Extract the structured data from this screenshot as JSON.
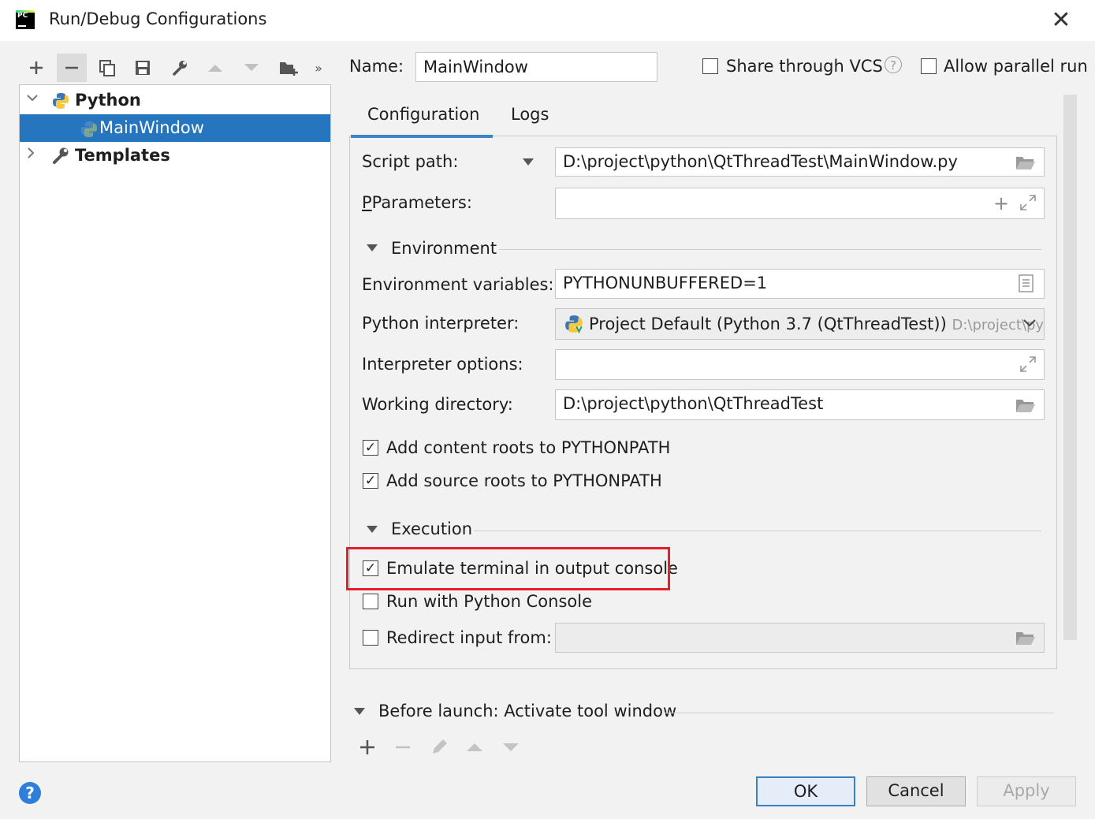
{
  "window": {
    "title": "Run/Debug Configurations"
  },
  "tree": {
    "python_label": "Python",
    "mainwindow_label": "MainWindow",
    "templates_label": "Templates"
  },
  "header": {
    "name_label": "Name:",
    "name_value": "MainWindow",
    "share_vcs_label": "Share through VCS",
    "allow_parallel_label": "Allow parallel run"
  },
  "tabs": [
    {
      "label": "Configuration"
    },
    {
      "label": "Logs"
    }
  ],
  "config": {
    "script_path_label": "Script path:",
    "script_path_value": "D:\\project\\python\\QtThreadTest\\MainWindow.py",
    "parameters_label": "Parameters:",
    "parameters_value": "",
    "environment_section": "Environment",
    "env_vars_label": "Environment variables:",
    "env_vars_value": "PYTHONUNBUFFERED=1",
    "interpreter_label": "Python interpreter:",
    "interpreter_value": "Project Default (Python 3.7 (QtThreadTest))",
    "interpreter_path": "D:\\project\\py",
    "interpreter_options_label": "Interpreter options:",
    "interpreter_options_value": "",
    "working_dir_label": "Working directory:",
    "working_dir_value": "D:\\project\\python\\QtThreadTest",
    "add_content_roots_label": "Add content roots to PYTHONPATH",
    "add_content_roots_checked": true,
    "add_source_roots_label": "Add source roots to PYTHONPATH",
    "add_source_roots_checked": true,
    "execution_section": "Execution",
    "emulate_terminal_label": "Emulate terminal in output console",
    "emulate_terminal_checked": true,
    "run_python_console_label": "Run with Python Console",
    "run_python_console_checked": false,
    "redirect_input_label": "Redirect input from:",
    "redirect_input_checked": false,
    "redirect_input_value": ""
  },
  "before_launch": {
    "label": "Before launch: Activate tool window"
  },
  "buttons": {
    "ok": "OK",
    "cancel": "Cancel",
    "apply": "Apply"
  },
  "colors": {
    "selection": "#2675bf",
    "highlight": "#e0202a",
    "tab_underline": "#4083c9"
  }
}
